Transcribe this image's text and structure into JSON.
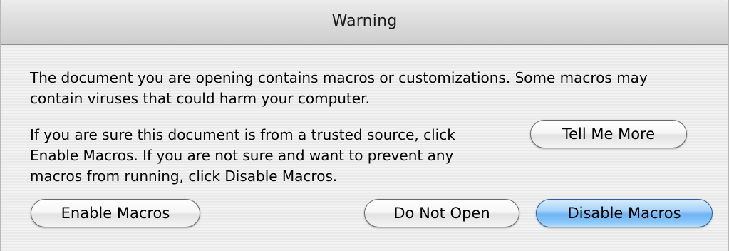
{
  "window": {
    "title": "Warning"
  },
  "message": {
    "paragraph1": "The document you are opening contains macros or customizations. Some macros may contain viruses that could harm your computer.",
    "paragraph2": "If you are sure this document is from a trusted source, click Enable Macros. If you are not sure and want to prevent any macros from running, click Disable Macros."
  },
  "buttons": {
    "tell_me_more": "Tell Me More",
    "enable_macros": "Enable Macros",
    "do_not_open": "Do Not Open",
    "disable_macros": "Disable Macros"
  },
  "colors": {
    "default_button": "#8cc8fb",
    "background": "#ededed"
  }
}
